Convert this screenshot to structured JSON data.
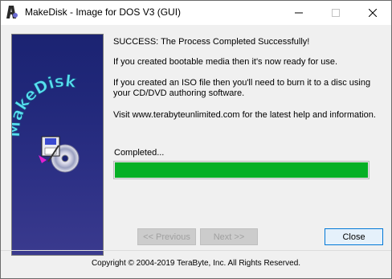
{
  "window": {
    "title": "MakeDisk - Image for DOS V3 (GUI)",
    "controls": {
      "minimize": "minimize",
      "maximize": "maximize",
      "close": "close"
    }
  },
  "banner": {
    "logo_text": "MakeDisk"
  },
  "messages": {
    "success": "SUCCESS: The Process Completed Successfully!",
    "bootable": "If you created bootable media then it's now ready for use.",
    "iso": "If you created an ISO file then you'll need to burn it to a disc using your CD/DVD authoring software.",
    "visit": "Visit www.terabyteunlimited.com for the latest help and information."
  },
  "progress": {
    "label": "Completed...",
    "value": 1.0,
    "color": "#06b025"
  },
  "buttons": {
    "previous": "<< Previous",
    "next": "Next >>",
    "close": "Close"
  },
  "footer": {
    "copyright": "Copyright © 2004-2019 TeraByte, Inc.  All Rights Reserved."
  },
  "icons": {
    "app": "makedisk-app-icon",
    "banner": "disk-cd-icon"
  }
}
